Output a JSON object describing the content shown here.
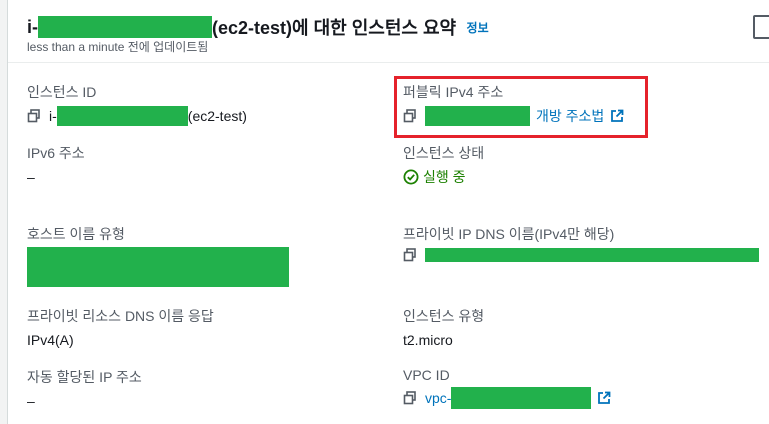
{
  "header": {
    "title_prefix": "i-",
    "title_suffix": "(ec2-test)에 대한 인스턴스 요약",
    "info_link": "정보",
    "subtitle": "less than a minute 전에 업데이트됨"
  },
  "fields": {
    "instance_id": {
      "label": "인스턴스 ID",
      "prefix": "i-",
      "suffix": "(ec2-test)"
    },
    "ipv6": {
      "label": "IPv6 주소",
      "value": "–"
    },
    "hostname_type": {
      "label": "호스트 이름 유형"
    },
    "private_dns_response": {
      "label": "프라이빗 리소스 DNS 이름 응답",
      "value": "IPv4(A)"
    },
    "auto_ip": {
      "label": "자동 할당된 IP 주소",
      "value": "–"
    },
    "public_ipv4": {
      "label": "퍼블릭 IPv4 주소",
      "open_link": "개방 주소법"
    },
    "instance_state": {
      "label": "인스턴스 상태",
      "value": "실행 중"
    },
    "private_ip_dns": {
      "label": "프라이빗 IP DNS 이름(IPv4만 해당)"
    },
    "instance_type": {
      "label": "인스턴스 유형",
      "value": "t2.micro"
    },
    "vpc_id": {
      "label": "VPC ID",
      "prefix": "vpc-"
    }
  },
  "colors": {
    "link": "#0073bb",
    "success": "#1d8102",
    "redaction": "#22b14c",
    "highlight": "#e5222b"
  }
}
